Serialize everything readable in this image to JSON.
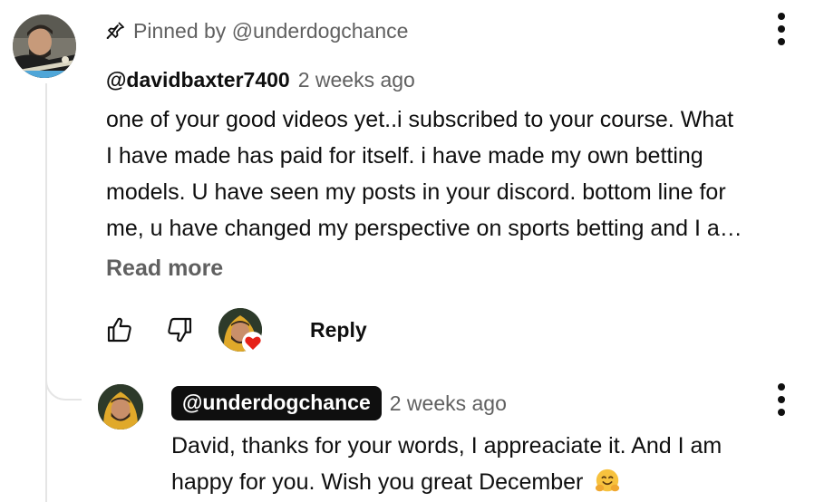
{
  "comment": {
    "pinned_label": "Pinned by @underdogchance",
    "author": "@davidbaxter7400",
    "time": "2 weeks ago",
    "text_lines": [
      "one of your good videos yet..i subscribed  to your course.  What",
      "I have made has paid for itself.   i have made my own betting",
      "models.  U have seen my posts in your discord.  bottom line for",
      "me, u have changed my perspective on sports betting and I a…"
    ],
    "read_more": "Read more",
    "reply_label": "Reply",
    "icons": {
      "pin": "pin-icon",
      "like": "thumbs-up-icon",
      "dislike": "thumbs-down-icon",
      "hearted": "creator-heart-icon",
      "menu": "more-vert-icon"
    }
  },
  "reply": {
    "author": "@underdogchance",
    "time": "2 weeks ago",
    "text_lines": [
      "David, thanks for your words, I appreaciate it. And I am",
      "happy for you. Wish you great December"
    ],
    "emoji": "hugging-face-emoji"
  },
  "colors": {
    "text": "#0f0f0f",
    "secondary": "#606060",
    "heart": "#e62117",
    "owner_badge_bg": "#0f0f0f",
    "thread_line": "#e5e5e5"
  }
}
